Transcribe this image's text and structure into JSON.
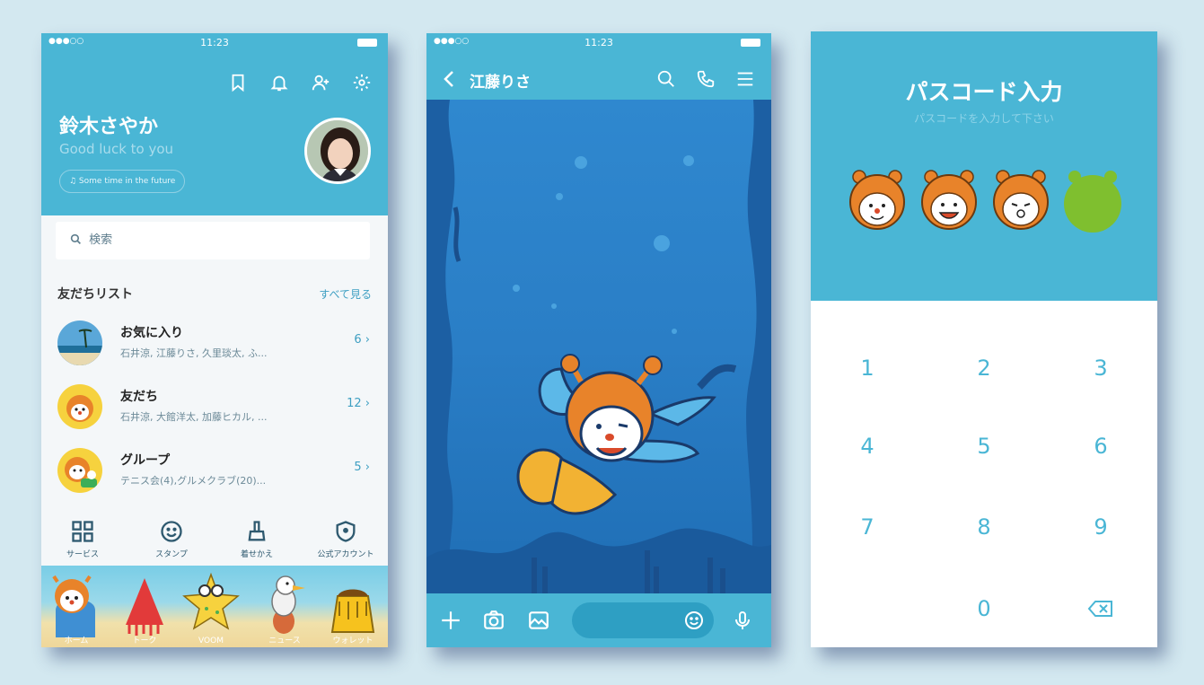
{
  "phone1": {
    "status": {
      "time": "11:23",
      "signal": "●●●○○"
    },
    "header": {
      "icons": [
        "bookmark-icon",
        "bell-icon",
        "add-friend-icon",
        "settings-icon"
      ],
      "name": "鈴木さやか",
      "status_message": "Good luck to you",
      "music": "♫ Some time in the future"
    },
    "search": {
      "placeholder": "検索"
    },
    "friends_list": {
      "title": "友だちリスト",
      "see_all": "すべて見る",
      "rows": [
        {
          "label": "お気に入り",
          "sub": "石井涼, 江藤りさ, 久里琰太, ふ...",
          "count": "6 ›"
        },
        {
          "label": "友だち",
          "sub": "石井涼, 大館洋太, 加藤ヒカル, ...",
          "count": "12 ›"
        },
        {
          "label": "グループ",
          "sub": "テニス会(4),グルメクラブ(20)...",
          "count": "5 ›"
        }
      ]
    },
    "shortcuts": [
      {
        "label": "サービス",
        "icon": "grid-icon"
      },
      {
        "label": "スタンプ",
        "icon": "smiley-icon"
      },
      {
        "label": "着せかえ",
        "icon": "brush-icon"
      },
      {
        "label": "公式アカウント",
        "icon": "shield-icon"
      }
    ],
    "tabs": [
      {
        "label": "ホーム"
      },
      {
        "label": "トーク"
      },
      {
        "label": "VOOM"
      },
      {
        "label": "ニュース"
      },
      {
        "label": "ウォレット"
      }
    ]
  },
  "phone2": {
    "status": {
      "time": "11:23",
      "signal": "●●●○○"
    },
    "header": {
      "title": "江藤りさ",
      "icons": [
        "search-icon",
        "phone-icon",
        "menu-icon"
      ]
    },
    "bottom_bar": {
      "icons": [
        "plus-icon",
        "camera-icon",
        "image-icon",
        "emoji-icon",
        "mic-icon"
      ]
    }
  },
  "phone3": {
    "title": "パスコード入力",
    "subtitle": "パスコードを入力して下さい",
    "keypad": [
      "1",
      "2",
      "3",
      "4",
      "5",
      "6",
      "7",
      "8",
      "9",
      "0"
    ],
    "colors": {
      "accent": "#4ab6d5",
      "empty_dot": "#7fbf2f"
    }
  }
}
